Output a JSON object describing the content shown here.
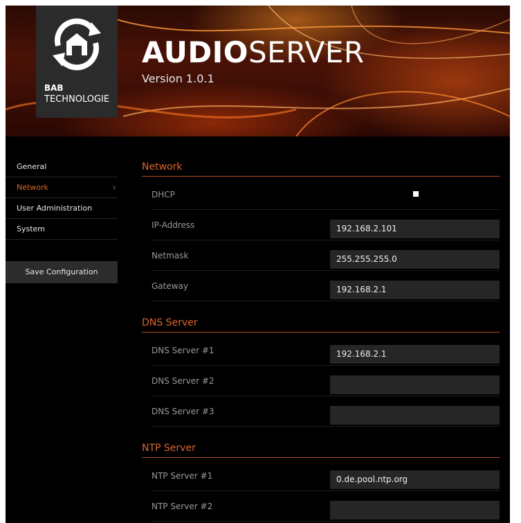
{
  "brand": {
    "line1": "BAB",
    "line2": "TECHNOLOGIE",
    "logo_icon": "house-sync-icon"
  },
  "app": {
    "title_bold": "AUDIO",
    "title_light": "SERVER",
    "version": "Version 1.0.1"
  },
  "colors": {
    "accent": "#e0632a",
    "background": "#000000",
    "field": "#262626"
  },
  "sidebar": {
    "items": [
      {
        "label": "General",
        "active": false
      },
      {
        "label": "Network",
        "active": true
      },
      {
        "label": "User Administration",
        "active": false
      },
      {
        "label": "System",
        "active": false
      }
    ],
    "save_label": "Save Configuration"
  },
  "network": {
    "title": "Network",
    "dhcp_label": "DHCP",
    "dhcp_checked": false,
    "ip_label": "IP-Address",
    "ip_value": "192.168.2.101",
    "netmask_label": "Netmask",
    "netmask_value": "255.255.255.0",
    "gateway_label": "Gateway",
    "gateway_value": "192.168.2.1"
  },
  "dns": {
    "title": "DNS Server",
    "dns1_label": "DNS Server #1",
    "dns1_value": "192.168.2.1",
    "dns2_label": "DNS Server #2",
    "dns2_value": "",
    "dns3_label": "DNS Server #3",
    "dns3_value": ""
  },
  "ntp": {
    "title": "NTP Server",
    "ntp1_label": "NTP Server #1",
    "ntp1_value": "0.de.pool.ntp.org",
    "ntp2_label": "NTP Server #2",
    "ntp2_value": ""
  }
}
